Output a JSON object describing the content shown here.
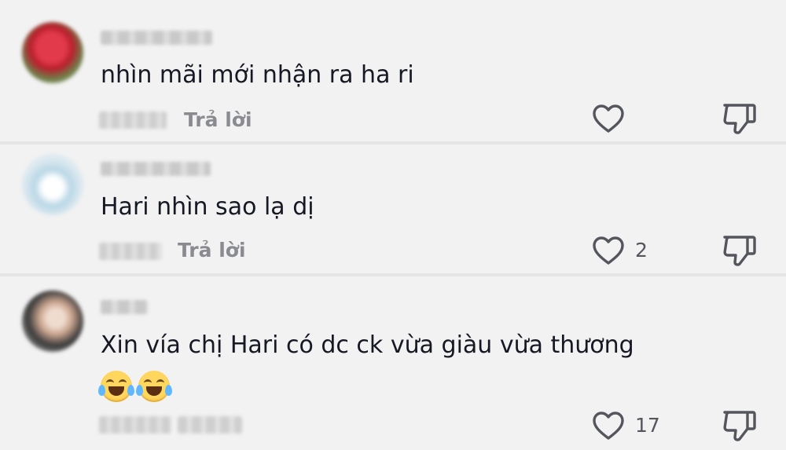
{
  "comments": [
    {
      "text": "nhìn mãi mới nhận ra ha ri",
      "reply_label": "Trả lời",
      "like_count": ""
    },
    {
      "text": "Hari nhìn sao lạ dị",
      "reply_label": "Trả lời",
      "like_count": "2"
    },
    {
      "text": "Xin vía chị Hari có dc ck vừa giàu vừa thương",
      "emoji": [
        "face-with-tears-of-joy",
        "face-with-tears-of-joy"
      ],
      "reply_label": "",
      "like_count": "17"
    }
  ],
  "colors": {
    "background": "#f2f2f2",
    "text": "#161823",
    "secondary_text": "#8a8b91",
    "icon_stroke": "#55565d"
  },
  "icons": [
    "heart-outline-icon",
    "thumbs-down-outline-icon"
  ]
}
